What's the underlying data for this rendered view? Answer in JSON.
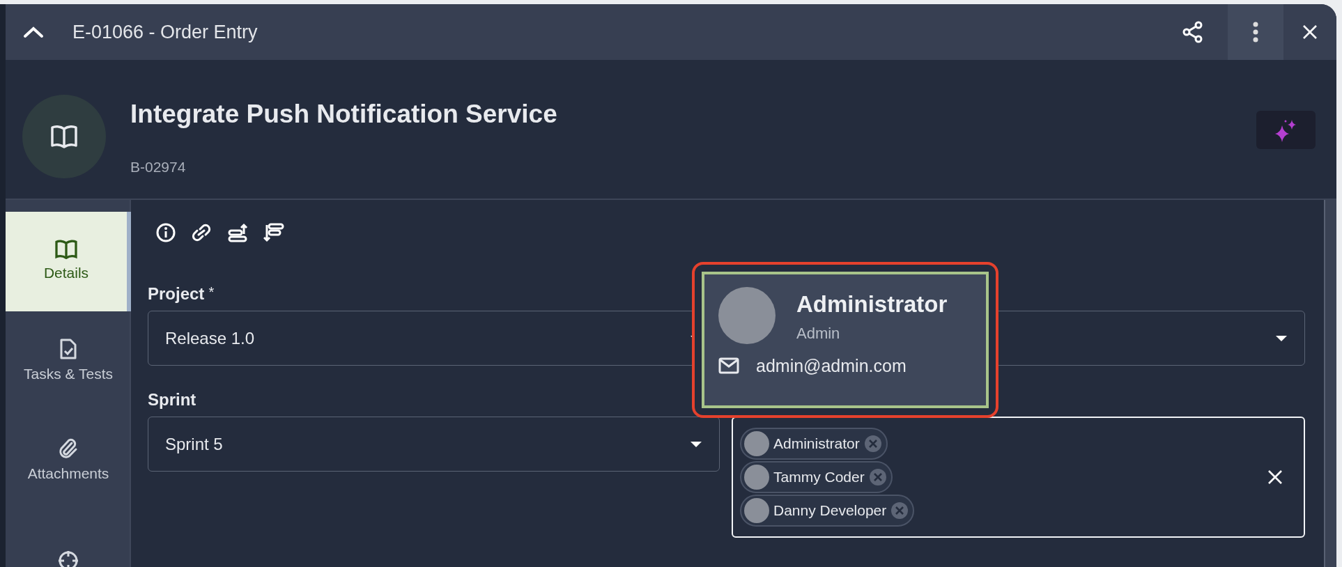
{
  "window": {
    "title": "E-01066 - Order Entry"
  },
  "header": {
    "title": "Integrate Push Notification Service",
    "item_id": "B-02974"
  },
  "sidebar": {
    "items": [
      {
        "label": "Details",
        "selected": true
      },
      {
        "label": "Tasks & Tests",
        "selected": false
      },
      {
        "label": "Attachments",
        "selected": false
      },
      {
        "selected": false
      }
    ]
  },
  "fields": [
    {
      "kind": "select",
      "label": "Project",
      "required_mark": "*",
      "value": "Release 1.0"
    },
    {
      "kind": "select"
    },
    {
      "kind": "select",
      "label": "Sprint",
      "value": "Sprint 5"
    },
    {
      "kind": "people",
      "focused": true,
      "people": [
        {
          "name": "Administrator"
        },
        {
          "name": "Tammy Coder"
        },
        {
          "name": "Danny Developer"
        }
      ]
    }
  ],
  "popup": {
    "name": "Administrator",
    "role": "Admin",
    "email": "admin@admin.com"
  }
}
